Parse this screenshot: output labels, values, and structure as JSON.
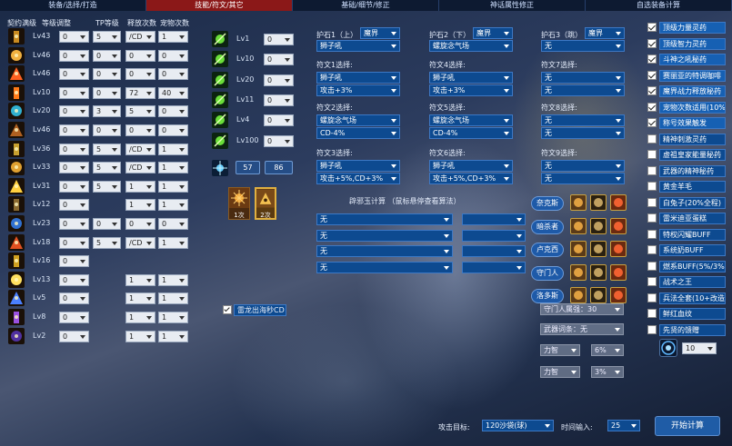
{
  "tabs": [
    "装备/选择/打造",
    "技能/符文/其它",
    "基础/细节/修正",
    "神话属性修正",
    "自选装备计算"
  ],
  "headers": {
    "contract": "契约满级",
    "level_adjust": "等级调整",
    "tp": "TP等级",
    "release": "释放次数",
    "pet": "宠物次数"
  },
  "skills": [
    {
      "icon": "tower-icon",
      "lv": "Lv43",
      "a": "0",
      "b": "5",
      "c": "/CD",
      "d": "1"
    },
    {
      "icon": "comet-icon",
      "lv": "Lv46",
      "a": "0",
      "b": "0",
      "c": "0",
      "d": "0"
    },
    {
      "icon": "fire-burst-icon",
      "lv": "Lv46",
      "a": "0",
      "b": "0",
      "c": "0",
      "d": "0"
    },
    {
      "icon": "flame-dash-icon",
      "lv": "Lv10",
      "a": "0",
      "b": "0",
      "c": "72",
      "d": "40"
    },
    {
      "icon": "cyan-slash-icon",
      "lv": "Lv20",
      "a": "0",
      "b": "3",
      "c": "5",
      "d": "0"
    },
    {
      "icon": "meteor-icon",
      "lv": "Lv46",
      "a": "0",
      "b": "0",
      "c": "0",
      "d": "0"
    },
    {
      "icon": "pillar-icon",
      "lv": "Lv36",
      "a": "0",
      "b": "5",
      "c": "/CD",
      "d": "1"
    },
    {
      "icon": "golden-warrior-icon",
      "lv": "Lv33",
      "a": "0",
      "b": "5",
      "c": "/CD",
      "d": "1"
    },
    {
      "icon": "star-burst-icon",
      "lv": "Lv31",
      "a": "0",
      "b": "5",
      "c": "1",
      "d": "1"
    },
    {
      "icon": "rune-pillar-icon",
      "lv": "Lv12",
      "a": "0",
      "b": "",
      "c": "1",
      "d": "1"
    },
    {
      "icon": "blue-orb-icon",
      "lv": "Lv23",
      "a": "0",
      "b": "0",
      "c": "0",
      "d": "0"
    },
    {
      "icon": "cross-flame-icon",
      "lv": "Lv18",
      "a": "0",
      "b": "5",
      "c": "/CD",
      "d": "1"
    },
    {
      "icon": "gold-cross-icon",
      "lv": "Lv16",
      "a": "0",
      "b": "",
      "c": "",
      "d": ""
    },
    {
      "icon": "sun-flare-icon",
      "lv": "Lv13",
      "a": "0",
      "b": "",
      "c": "1",
      "d": "1"
    },
    {
      "icon": "blue-blade-icon",
      "lv": "Lv5",
      "a": "0",
      "b": "",
      "c": "1",
      "d": "1"
    },
    {
      "icon": "violet-tornado-icon",
      "lv": "Lv8",
      "a": "0",
      "b": "",
      "c": "1",
      "d": "1"
    },
    {
      "icon": "dark-lightning-icon",
      "lv": "Lv2",
      "a": "0",
      "b": "",
      "c": "1",
      "d": "1"
    }
  ],
  "passives": [
    {
      "icon": "leaf-blade-icon",
      "lv": "Lv1",
      "v": "0"
    },
    {
      "icon": "twin-figures-icon",
      "lv": "Lv10",
      "v": "0"
    },
    {
      "icon": "spiral-icon",
      "lv": "Lv20",
      "v": "0"
    },
    {
      "icon": "green-ring-icon",
      "lv": "Lv11",
      "v": "0"
    },
    {
      "icon": "green-aura-icon",
      "lv": "Lv4",
      "v": "0"
    },
    {
      "icon": "green-runner-icon",
      "lv": "Lv100",
      "v": "0"
    }
  ],
  "extra": {
    "icon": "blue-spark-icon",
    "a": "57",
    "b": "86"
  },
  "portrait": {
    "a": "1次",
    "b": "2次"
  },
  "thunder_check": "雷龙出海秒CD",
  "guards": [
    {
      "title": "护石1（上）",
      "type": "魔界",
      "value": "狮子吼"
    },
    {
      "title": "护石2（下）",
      "type": "魔界",
      "value": "螺旋念气场"
    },
    {
      "title": "护石3（跳）",
      "type": "魔界",
      "value": "无"
    }
  ],
  "runes": [
    [
      {
        "title": "符文1选择:",
        "skill": "狮子吼",
        "eff": "攻击+3%"
      },
      {
        "title": "符文4选择:",
        "skill": "狮子吼",
        "eff": "攻击+3%"
      },
      {
        "title": "符文7选择:",
        "skill": "无",
        "eff": "无"
      }
    ],
    [
      {
        "title": "符文2选择:",
        "skill": "螺旋念气场",
        "eff": "CD-4%"
      },
      {
        "title": "符文5选择:",
        "skill": "螺旋念气场",
        "eff": "CD-4%"
      },
      {
        "title": "符文8选择:",
        "skill": "无",
        "eff": "无"
      }
    ],
    [
      {
        "title": "符文3选择:",
        "skill": "狮子吼",
        "eff": "攻击+5%,CD+3%"
      },
      {
        "title": "符文6选择:",
        "skill": "狮子吼",
        "eff": "攻击+5%,CD+3%"
      },
      {
        "title": "符文9选择:",
        "skill": "无",
        "eff": "无"
      }
    ]
  ],
  "seal": {
    "title": "辟邪玉计算 （鼠标悬停查看算法）",
    "rows": [
      {
        "a": "无",
        "b": ""
      },
      {
        "a": "无",
        "b": ""
      },
      {
        "a": "无",
        "b": ""
      },
      {
        "a": "无",
        "b": ""
      }
    ]
  },
  "fighters": [
    "奈克斯",
    "暗杀者",
    "卢克西",
    "守门人",
    "洛多斯"
  ],
  "gatekeeper": "守门人属强：30",
  "weapon_grind": "武器词条：无",
  "strength_rows": [
    {
      "a": "力智",
      "b": "6%"
    },
    {
      "a": "力智",
      "b": "3%"
    }
  ],
  "buffs": [
    {
      "label": "顶级力量灵药",
      "on": true
    },
    {
      "label": "顶级智力灵药",
      "on": true
    },
    {
      "label": "斗神之吼秘药",
      "on": true
    },
    {
      "label": "赛丽亚的特调咖啡",
      "on": true
    },
    {
      "label": "魔界战力释放秘药",
      "on": true
    },
    {
      "label": "宠物次数适用(10%)",
      "on": true
    },
    {
      "label": "称号效果触发",
      "on": true
    },
    {
      "label": "精神刺激灵药",
      "on": false
    },
    {
      "label": "虚祖皇家能量秘药",
      "on": false
    },
    {
      "label": "武器的精神秘药",
      "on": false
    },
    {
      "label": "黄金羊毛",
      "on": false
    },
    {
      "label": "白兔子(20%全程)",
      "on": false
    },
    {
      "label": "雷米迪亚蛋糕",
      "on": false
    },
    {
      "label": "特权闪耀BUFF",
      "on": false
    },
    {
      "label": "系统奶BUFF",
      "on": false
    },
    {
      "label": "燃系BUFF(5%/3%)",
      "on": false
    },
    {
      "label": "战术之王",
      "on": false
    },
    {
      "label": "兵法全套(10+改造)",
      "on": false
    },
    {
      "label": "鲜红血纹",
      "on": false
    },
    {
      "label": "先贤的馈赠",
      "on": false
    }
  ],
  "buff_level": "10",
  "attack_target": "攻击目标:",
  "target_value": "120沙袋(球)",
  "time_input": "时间输入:",
  "time_value": "25",
  "calc_button": "开始计算"
}
